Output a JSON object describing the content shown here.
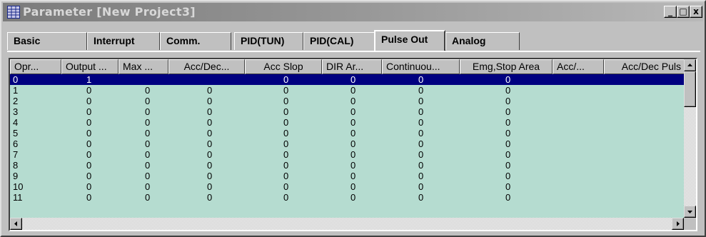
{
  "window": {
    "title": "Parameter [New Project3]",
    "minimize": "_",
    "restore": "□",
    "close": "x"
  },
  "tabs": [
    "Basic",
    "Interrupt",
    "Comm.",
    "PID(TUN)",
    "PID(CAL)",
    "Pulse Out",
    "Analog"
  ],
  "active_tab": "Pulse Out",
  "table": {
    "columns": [
      "Opr...",
      "Output ...",
      "Max ...",
      "Acc/Dec...",
      "Acc Slop",
      "DIR Ar...",
      "Continuou...",
      "Emg,Stop Area",
      "Acc/...",
      "Acc/Dec Puls"
    ],
    "rows": [
      [
        "0",
        "1",
        "",
        "",
        "0",
        "0",
        "0",
        "0",
        "",
        ""
      ],
      [
        "1",
        "0",
        "0",
        "0",
        "0",
        "0",
        "0",
        "0",
        "",
        ""
      ],
      [
        "2",
        "0",
        "0",
        "0",
        "0",
        "0",
        "0",
        "0",
        "",
        ""
      ],
      [
        "3",
        "0",
        "0",
        "0",
        "0",
        "0",
        "0",
        "0",
        "",
        ""
      ],
      [
        "4",
        "0",
        "0",
        "0",
        "0",
        "0",
        "0",
        "0",
        "",
        ""
      ],
      [
        "5",
        "0",
        "0",
        "0",
        "0",
        "0",
        "0",
        "0",
        "",
        ""
      ],
      [
        "6",
        "0",
        "0",
        "0",
        "0",
        "0",
        "0",
        "0",
        "",
        ""
      ],
      [
        "7",
        "0",
        "0",
        "0",
        "0",
        "0",
        "0",
        "0",
        "",
        ""
      ],
      [
        "8",
        "0",
        "0",
        "0",
        "0",
        "0",
        "0",
        "0",
        "",
        ""
      ],
      [
        "9",
        "0",
        "0",
        "0",
        "0",
        "0",
        "0",
        "0",
        "",
        ""
      ],
      [
        "10",
        "0",
        "0",
        "0",
        "0",
        "0",
        "0",
        "0",
        "",
        ""
      ],
      [
        "11",
        "0",
        "0",
        "0",
        "0",
        "0",
        "0",
        "0",
        "",
        ""
      ]
    ],
    "selected_row": 0
  },
  "colors": {
    "grid_bg": "#b5dcd0",
    "selection": "#000080",
    "face": "#c0c0c0"
  },
  "icons": {
    "app": "grid-icon",
    "scroll_up": "up-arrow-icon",
    "scroll_down": "down-arrow-icon",
    "scroll_left": "left-arrow-icon",
    "scroll_right": "right-arrow-icon"
  }
}
